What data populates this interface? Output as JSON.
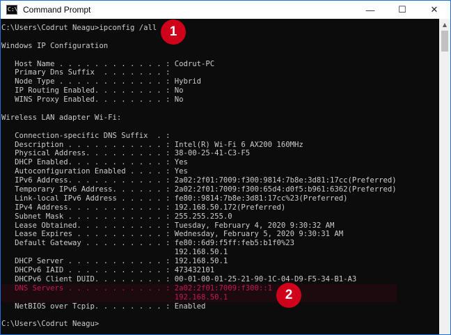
{
  "window": {
    "title": "Command Prompt",
    "icon_text": "C:\\",
    "minimize": "—",
    "maximize": "☐",
    "close": "✕"
  },
  "console": {
    "lines": [
      {
        "label": "C:\\Users\\Codrut Neagu>ipconfig /all",
        "value": ""
      },
      {
        "label": "",
        "value": ""
      },
      {
        "label": "Windows IP Configuration",
        "value": ""
      },
      {
        "label": "",
        "value": ""
      },
      {
        "label": "   Host Name . . . . . . . . . . . . : ",
        "value": "Codrut-PC"
      },
      {
        "label": "   Primary Dns Suffix  . . . . . . . : ",
        "value": ""
      },
      {
        "label": "   Node Type . . . . . . . . . . . . : ",
        "value": "Hybrid"
      },
      {
        "label": "   IP Routing Enabled. . . . . . . . : ",
        "value": "No"
      },
      {
        "label": "   WINS Proxy Enabled. . . . . . . . : ",
        "value": "No"
      },
      {
        "label": "",
        "value": ""
      },
      {
        "label": "Wireless LAN adapter Wi-Fi:",
        "value": ""
      },
      {
        "label": "",
        "value": ""
      },
      {
        "label": "   Connection-specific DNS Suffix  . : ",
        "value": ""
      },
      {
        "label": "   Description . . . . . . . . . . . : ",
        "value": "Intel(R) Wi-Fi 6 AX200 160MHz"
      },
      {
        "label": "   Physical Address. . . . . . . . . : ",
        "value": "38-00-25-41-C3-F5"
      },
      {
        "label": "   DHCP Enabled. . . . . . . . . . . : ",
        "value": "Yes"
      },
      {
        "label": "   Autoconfiguration Enabled . . . . : ",
        "value": "Yes"
      },
      {
        "label": "   IPv6 Address. . . . . . . . . . . : ",
        "value": "2a02:2f01:7009:f300:9814:7b8e:3d81:17cc(Preferred)"
      },
      {
        "label": "   Temporary IPv6 Address. . . . . . : ",
        "value": "2a02:2f01:7009:f300:65d4:d0f5:b961:6362(Preferred)"
      },
      {
        "label": "   Link-local IPv6 Address . . . . . : ",
        "value": "fe80::9814:7b8e:3d81:17cc%23(Preferred)"
      },
      {
        "label": "   IPv4 Address. . . . . . . . . . . : ",
        "value": "192.168.50.172(Preferred)"
      },
      {
        "label": "   Subnet Mask . . . . . . . . . . . : ",
        "value": "255.255.255.0"
      },
      {
        "label": "   Lease Obtained. . . . . . . . . . : ",
        "value": "Tuesday, February 4, 2020 9:30:32 AM"
      },
      {
        "label": "   Lease Expires . . . . . . . . . . : ",
        "value": "Wednesday, February 5, 2020 9:30:31 AM"
      },
      {
        "label": "   Default Gateway . . . . . . . . . : ",
        "value": "fe80::6d9:f5ff:feb5:b1f0%23"
      },
      {
        "label": "                                       ",
        "value": "192.168.50.1"
      },
      {
        "label": "   DHCP Server . . . . . . . . . . . : ",
        "value": "192.168.50.1"
      },
      {
        "label": "   DHCPv6 IAID . . . . . . . . . . . : ",
        "value": "473432101"
      },
      {
        "label": "   DHCPv6 Client DUID. . . . . . . . : ",
        "value": "00-01-00-01-25-21-90-1C-04-D9-F5-34-B1-A3"
      },
      {
        "label": "   DNS Servers . . . . . . . . . . . : ",
        "value": "2a02:2f01:7009:f300::1",
        "highlight": true
      },
      {
        "label": "                                       ",
        "value": "192.168.50.1",
        "highlight": true
      },
      {
        "label": "   NetBIOS over Tcpip. . . . . . . . : ",
        "value": "Enabled"
      },
      {
        "label": "",
        "value": ""
      },
      {
        "label": "C:\\Users\\Codrut Neagu>",
        "value": ""
      }
    ]
  },
  "annotations": {
    "badge1": "1",
    "badge2": "2",
    "badge_color": "#d0021b",
    "highlight_color": "#c2185b"
  }
}
